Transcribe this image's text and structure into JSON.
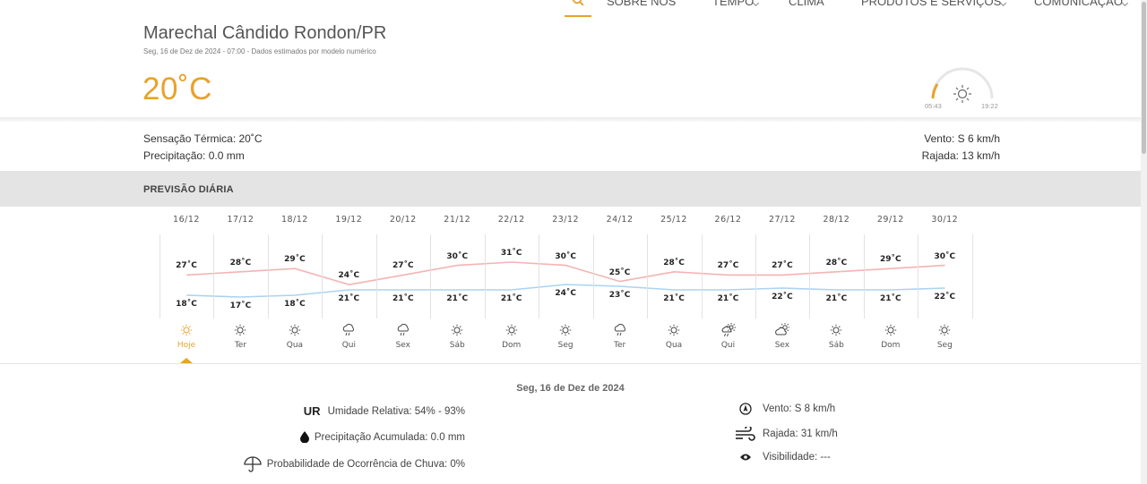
{
  "nav": {
    "items": [
      {
        "label": "SOBRE NÓS",
        "chevron": false
      },
      {
        "label": "TEMPO",
        "chevron": true
      },
      {
        "label": "CLIMA",
        "chevron": false
      },
      {
        "label": "PRODUTOS E SERVIÇOS",
        "chevron": true
      },
      {
        "label": "COMUNICAÇÃO",
        "chevron": true
      }
    ]
  },
  "location": {
    "city": "Marechal Cândido Rondon/PR",
    "subtitle": "Seg, 16 de Dez de 2024 - 07:00 - Dados estimados por modelo numérico"
  },
  "current": {
    "temperature": "20˚C",
    "sunrise": "05:43",
    "sunset": "19:22",
    "feels_like": "Sensação Térmica: 20˚C",
    "precipitation": "Precipitação: 0.0 mm",
    "wind": "Vento: S 6 km/h",
    "gust": "Rajada: 13 km/h"
  },
  "section_title": "PREVISÃO DIÁRIA",
  "forecast": {
    "days": [
      {
        "date": "16/12",
        "name": "Hoje",
        "max": 27,
        "min": 18,
        "icon": "sun-icon",
        "active": true
      },
      {
        "date": "17/12",
        "name": "Ter",
        "max": 28,
        "min": 17,
        "icon": "sun-icon"
      },
      {
        "date": "18/12",
        "name": "Qua",
        "max": 29,
        "min": 18,
        "icon": "sun-icon"
      },
      {
        "date": "19/12",
        "name": "Qui",
        "max": 24,
        "min": 21,
        "icon": "rain-icon"
      },
      {
        "date": "20/12",
        "name": "Sex",
        "max": 27,
        "min": 21,
        "icon": "rain-icon"
      },
      {
        "date": "21/12",
        "name": "Sáb",
        "max": 30,
        "min": 21,
        "icon": "sun-icon"
      },
      {
        "date": "22/12",
        "name": "Dom",
        "max": 31,
        "min": 21,
        "icon": "sun-icon"
      },
      {
        "date": "23/12",
        "name": "Seg",
        "max": 30,
        "min": 24,
        "icon": "sun-icon"
      },
      {
        "date": "24/12",
        "name": "Ter",
        "max": 25,
        "min": 23,
        "icon": "rain-icon"
      },
      {
        "date": "25/12",
        "name": "Qua",
        "max": 28,
        "min": 21,
        "icon": "sun-icon"
      },
      {
        "date": "26/12",
        "name": "Qui",
        "max": 27,
        "min": 21,
        "icon": "sun-rain-icon"
      },
      {
        "date": "27/12",
        "name": "Sex",
        "max": 27,
        "min": 22,
        "icon": "sun-cloud-icon"
      },
      {
        "date": "28/12",
        "name": "Sáb",
        "max": 28,
        "min": 21,
        "icon": "sun-icon"
      },
      {
        "date": "29/12",
        "name": "Dom",
        "max": 29,
        "min": 21,
        "icon": "sun-icon"
      },
      {
        "date": "30/12",
        "name": "Seg",
        "max": 30,
        "min": 22,
        "icon": "sun-icon"
      }
    ],
    "unit": "˚C",
    "max_color": "#f4b3b3",
    "min_color": "#a9d3f2"
  },
  "detail": {
    "date": "Seg, 16 de Dez de 2024",
    "ur_label": "UR",
    "humidity": "Umidade Relativa: 54% - 93%",
    "accum_precip": "Precipitação Acumulada: 0.0 mm",
    "rain_prob": "Probabilidade de Ocorrência de Chuva: 0%",
    "wind": "Vento: S 8 km/h",
    "gust": "Rajada: 31 km/h",
    "visibility": "Visibilidade: ---"
  },
  "colors": {
    "accent": "#e8a22b"
  }
}
